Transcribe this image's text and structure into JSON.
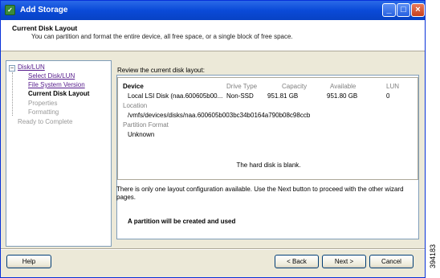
{
  "window": {
    "title": "Add Storage"
  },
  "header": {
    "title": "Current Disk Layout",
    "description": "You can partition and format the entire device, all free space, or a single block of free space."
  },
  "steps": {
    "root": "Disk/LUN",
    "select_disk": "Select Disk/LUN",
    "fs_version": "File System Version",
    "current_layout": "Current Disk Layout",
    "properties": "Properties",
    "formatting": "Formatting",
    "ready": "Ready to Complete"
  },
  "layout": {
    "review_label": "Review the current disk layout:",
    "columns": {
      "device": "Device",
      "drive_type": "Drive Type",
      "capacity": "Capacity",
      "available": "Available",
      "lun": "LUN"
    },
    "row": {
      "device": "Local LSI Disk (naa.600605b00...",
      "drive_type": "Non-SSD",
      "capacity": "951.81 GB",
      "available": "951.80 GB",
      "lun": "0"
    },
    "location_label": "Location",
    "location_value": "/vmfs/devices/disks/naa.600605b003bc34b0164a790b08c98ccb",
    "partition_format_label": "Partition Format",
    "partition_format_value": "Unknown",
    "blank_message": "The hard disk is blank.",
    "note": "There is only one layout configuration available. Use the Next button to proceed with the other wizard pages.",
    "partition_message": "A partition will be created and used"
  },
  "buttons": {
    "help": "Help",
    "back": "< Back",
    "next": "Next >",
    "cancel": "Cancel"
  },
  "figure_id": "394183"
}
